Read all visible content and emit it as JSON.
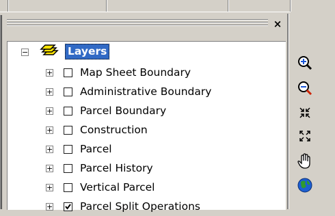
{
  "window": {
    "close_glyph": "×"
  },
  "toc": {
    "root": {
      "label": "Layers",
      "icon": "layers-icon",
      "expanded": true
    },
    "layers": [
      {
        "label": "Map Sheet Boundary",
        "checked": false
      },
      {
        "label": "Administrative Boundary",
        "checked": false
      },
      {
        "label": "Parcel Boundary",
        "checked": false
      },
      {
        "label": "Construction",
        "checked": false
      },
      {
        "label": "Parcel",
        "checked": false
      },
      {
        "label": "Parcel History",
        "checked": false
      },
      {
        "label": "Vertical Parcel",
        "checked": false
      },
      {
        "label": "Parcel Split Operations",
        "checked": true
      }
    ]
  },
  "toolbar": {
    "tools": [
      "zoom-in-icon",
      "zoom-out-icon",
      "fixed-zoom-in-icon",
      "fixed-zoom-out-icon",
      "pan-icon",
      "full-extent-icon"
    ]
  },
  "colors": {
    "selection": "#316ac5",
    "background": "#d4d0c8"
  }
}
